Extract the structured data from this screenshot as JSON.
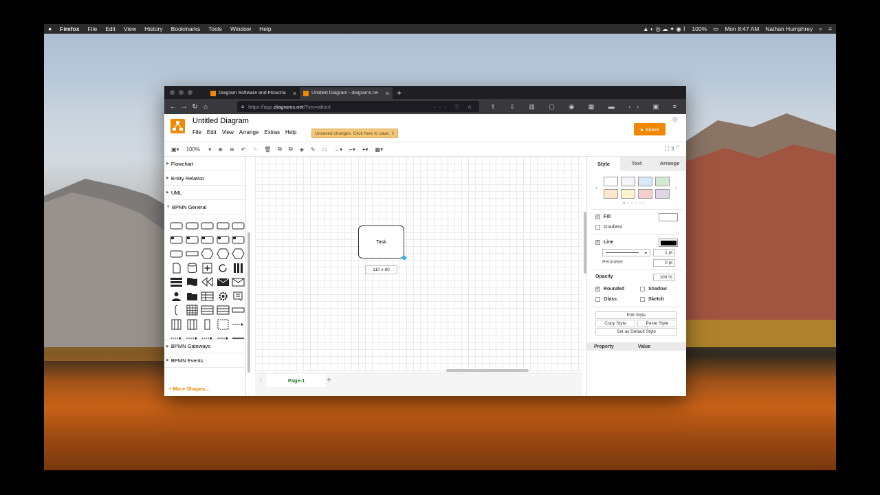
{
  "menubar": {
    "apple": "",
    "app": "Firefox",
    "items": [
      "File",
      "Edit",
      "View",
      "History",
      "Bookmarks",
      "Tools",
      "Window",
      "Help"
    ],
    "battery": "100%",
    "clock": "Mon 8:47 AM",
    "user": "Nathan Humphrey"
  },
  "browser": {
    "tabs": [
      {
        "label": "Diagram Software and Flowcha",
        "close": "×"
      },
      {
        "label": "Untitled Diagram - diagrams.ne",
        "close": "×"
      }
    ],
    "new_tab": "+",
    "url_prefix": "https://app.",
    "url_host": "diagrams.net",
    "url_suffix": "/?src=about",
    "url_icons": "··· ♡ ☆"
  },
  "drawio": {
    "title": "Untitled Diagram",
    "menu": [
      "File",
      "Edit",
      "View",
      "Arrange",
      "Extras",
      "Help"
    ],
    "unsaved": "Unsaved changes. Click here to save.",
    "share": "Share",
    "zoom": "100%",
    "sidebar": {
      "sections_top": [
        "Flowchart",
        "Entity Relation",
        "UML",
        "BPMN General"
      ],
      "sections_bottom": [
        "BPMN Gateways",
        "BPMN Events"
      ],
      "more": "+ More Shapes..."
    },
    "canvas": {
      "shape_label": "Task",
      "size_label": "110 x 80"
    },
    "pages": {
      "current": "Page-1",
      "add": "+",
      "menu": "⋮"
    },
    "format": {
      "tabs": [
        "Style",
        "Text",
        "Arrange"
      ],
      "fill": "Fill",
      "gradient": "Gradient",
      "line": "Line",
      "line_width": "1 pt",
      "perimeter": "Perimeter",
      "perimeter_value": "0 pt",
      "opacity": "Opacity",
      "opacity_value": "100 %",
      "rounded": "Rounded",
      "shadow": "Shadow",
      "glass": "Glass",
      "sketch": "Sketch",
      "edit_style": "Edit Style",
      "copy_style": "Copy Style",
      "paste_style": "Paste Style",
      "default_style": "Set as Default Style",
      "property": "Property",
      "value": "Value",
      "swatch_colors": [
        "#ffffff",
        "#f5f5f5",
        "#dae8fc",
        "#d5e8d4",
        "#ffe6cc",
        "#fff2cc",
        "#f8cecc",
        "#e1d5e7"
      ]
    }
  },
  "colors": {
    "accent": "#f08705",
    "page_tab": "#2c7a2c"
  }
}
